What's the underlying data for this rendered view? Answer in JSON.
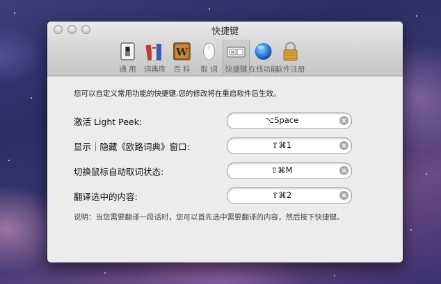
{
  "window": {
    "title": "快捷键"
  },
  "toolbar": {
    "items": [
      {
        "label": "通 用",
        "icon": "general-switch-icon",
        "selected": false
      },
      {
        "label": "词典库",
        "icon": "dictionary-books-icon",
        "selected": false
      },
      {
        "label": "百 科",
        "icon": "wikipedia-icon",
        "selected": false
      },
      {
        "label": "取 词",
        "icon": "mouse-icon",
        "selected": false
      },
      {
        "label": "快捷键",
        "icon": "keyboard-icon",
        "selected": true
      },
      {
        "label": "在线功能",
        "icon": "globe-icon",
        "selected": false
      },
      {
        "label": "软件注册",
        "icon": "padlock-icon",
        "selected": false
      }
    ]
  },
  "content": {
    "intro": "您可以自定义常用功能的快捷键,您的修改将在重启软件后生效。",
    "shortcuts": [
      {
        "label": "激活 Light Peek:",
        "value": "⌥Space"
      },
      {
        "label": "显示｜隐藏《欧路词典》窗口:",
        "value": "⇧⌘1"
      },
      {
        "label": "切换鼠标自动取词状态:",
        "value": "⇧⌘M"
      },
      {
        "label": "翻译选中的内容:",
        "value": "⇧⌘2"
      }
    ],
    "note": "说明：当您需要翻译一段话时，您可以首先选中需要翻译的内容，然后按下快捷键。"
  },
  "colors": {
    "accent_blue": "#2a7bd8",
    "lock_gold": "#d8a23a"
  }
}
